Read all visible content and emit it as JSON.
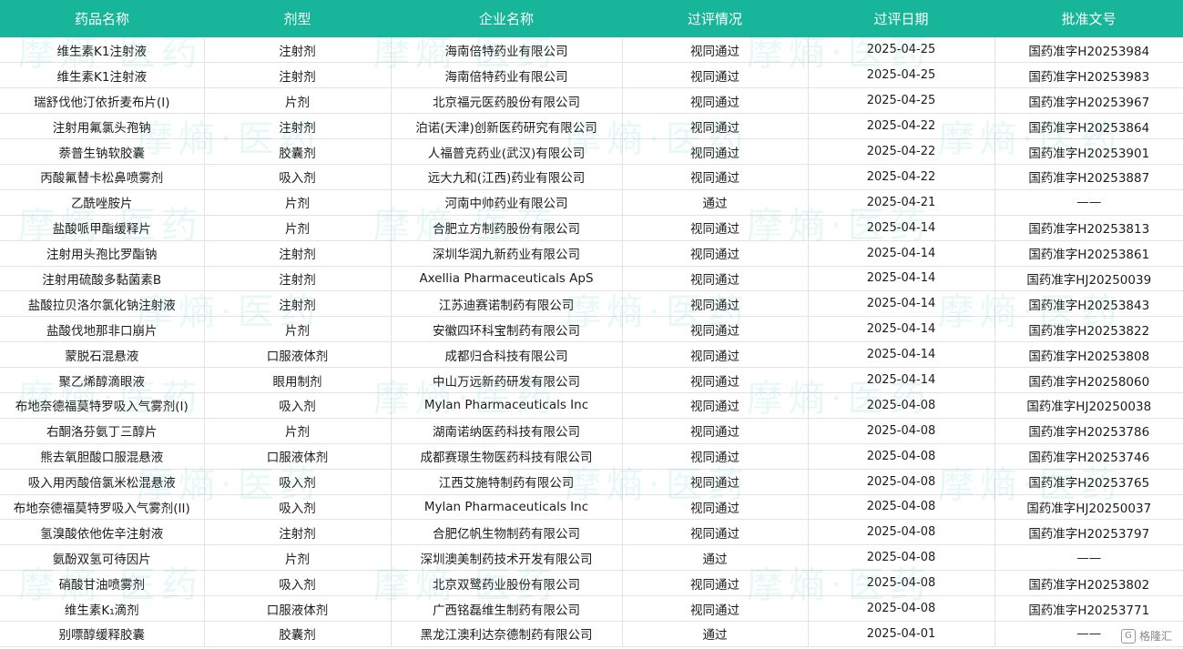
{
  "columns": [
    "药品名称",
    "剂型",
    "企业名称",
    "过评情况",
    "过评日期",
    "批准文号"
  ],
  "rows": [
    [
      "维生素K1注射液",
      "注射剂",
      "海南倍特药业有限公司",
      "视同通过",
      "2025-04-25",
      "国药准字H20253984"
    ],
    [
      "维生素K1注射液",
      "注射剂",
      "海南倍特药业有限公司",
      "视同通过",
      "2025-04-25",
      "国药准字H20253983"
    ],
    [
      "瑞舒伐他汀依折麦布片(I)",
      "片剂",
      "北京福元医药股份有限公司",
      "视同通过",
      "2025-04-25",
      "国药准字H20253967"
    ],
    [
      "注射用氟氯头孢钠",
      "注射剂",
      "泊诺(天津)创新医药研究有限公司",
      "视同通过",
      "2025-04-22",
      "国药准字H20253864"
    ],
    [
      "萘普生钠软胶囊",
      "胶囊剂",
      "人福普克药业(武汉)有限公司",
      "视同通过",
      "2025-04-22",
      "国药准字H20253901"
    ],
    [
      "丙酸氟替卡松鼻喷雾剂",
      "吸入剂",
      "远大九和(江西)药业有限公司",
      "视同通过",
      "2025-04-22",
      "国药准字H20253887"
    ],
    [
      "乙酰唑胺片",
      "片剂",
      "河南中帅药业有限公司",
      "通过",
      "2025-04-21",
      "——"
    ],
    [
      "盐酸哌甲酯缓释片",
      "片剂",
      "合肥立方制药股份有限公司",
      "视同通过",
      "2025-04-14",
      "国药准字H20253813"
    ],
    [
      "注射用头孢比罗酯钠",
      "注射剂",
      "深圳华润九新药业有限公司",
      "视同通过",
      "2025-04-14",
      "国药准字H20253861"
    ],
    [
      "注射用硫酸多黏菌素B",
      "注射剂",
      "Axellia Pharmaceuticals ApS",
      "视同通过",
      "2025-04-14",
      "国药准字HJ20250039"
    ],
    [
      "盐酸拉贝洛尔氯化钠注射液",
      "注射剂",
      "江苏迪赛诺制药有限公司",
      "视同通过",
      "2025-04-14",
      "国药准字H20253843"
    ],
    [
      "盐酸伐地那非口崩片",
      "片剂",
      "安徽四环科宝制药有限公司",
      "视同通过",
      "2025-04-14",
      "国药准字H20253822"
    ],
    [
      "蒙脱石混悬液",
      "口服液体剂",
      "成都归合科技有限公司",
      "视同通过",
      "2025-04-14",
      "国药准字H20253808"
    ],
    [
      "聚乙烯醇滴眼液",
      "眼用制剂",
      "中山万远新药研发有限公司",
      "视同通过",
      "2025-04-14",
      "国药准字H20258060"
    ],
    [
      "布地奈德福莫特罗吸入气雾剂(I)",
      "吸入剂",
      "Mylan Pharmaceuticals Inc",
      "视同通过",
      "2025-04-08",
      "国药准字HJ20250038"
    ],
    [
      "右酮洛芬氨丁三醇片",
      "片剂",
      "湖南诺纳医药科技有限公司",
      "视同通过",
      "2025-04-08",
      "国药准字H20253786"
    ],
    [
      "熊去氧胆酸口服混悬液",
      "口服液体剂",
      "成都赛璟生物医药科技有限公司",
      "视同通过",
      "2025-04-08",
      "国药准字H20253746"
    ],
    [
      "吸入用丙酸倍氯米松混悬液",
      "吸入剂",
      "江西艾施特制药有限公司",
      "视同通过",
      "2025-04-08",
      "国药准字H20253765"
    ],
    [
      "布地奈德福莫特罗吸入气雾剂(II)",
      "吸入剂",
      "Mylan Pharmaceuticals Inc",
      "视同通过",
      "2025-04-08",
      "国药准字HJ20250037"
    ],
    [
      "氢溴酸依他佐辛注射液",
      "注射剂",
      "合肥亿帆生物制药有限公司",
      "视同通过",
      "2025-04-08",
      "国药准字H20253797"
    ],
    [
      "氨酚双氢可待因片",
      "片剂",
      "深圳澳美制药技术开发有限公司",
      "通过",
      "2025-04-08",
      "——"
    ],
    [
      "硝酸甘油喷雾剂",
      "吸入剂",
      "北京双鹭药业股份有限公司",
      "视同通过",
      "2025-04-08",
      "国药准字H20253802"
    ],
    [
      "维生素K₁滴剂",
      "口服液体剂",
      "广西铭磊维生制药有限公司",
      "视同通过",
      "2025-04-08",
      "国药准字H20253771"
    ],
    [
      "别嘌醇缓释胶囊",
      "胶囊剂",
      "黑龙江澳利达奈德制药有限公司",
      "通过",
      "2025-04-01",
      "——"
    ]
  ],
  "watermark": {
    "text": "摩熵·医药"
  },
  "corner_badge": {
    "text": "格隆汇",
    "icon": "glh-logo-icon"
  },
  "colors": {
    "header_bg": "#17b69a",
    "header_text": "#ffffff",
    "grid": "#e3e3e3",
    "watermark": "#17b69a"
  }
}
